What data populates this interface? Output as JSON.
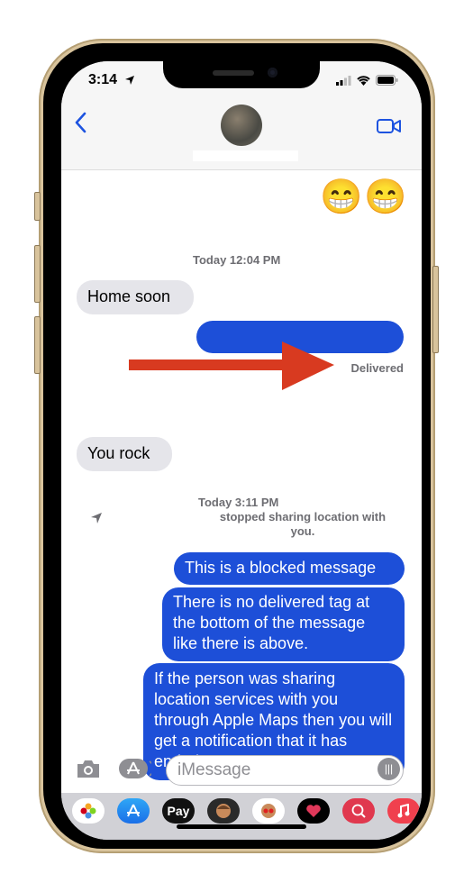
{
  "status_bar": {
    "time": "3:14"
  },
  "header": {
    "back_label": "‹"
  },
  "emojis": [
    "😁",
    "😁"
  ],
  "messages": {
    "timestamp_1": "Today 12:04 PM",
    "home_soon": "Home soon",
    "delivered": "Delivered",
    "you_rock": "You rock",
    "timestamp_2": "Today 3:11 PM",
    "location_notice": "stopped sharing location with you.",
    "blocked": "This is a blocked message",
    "no_tag": "There is no delivered tag at the bottom of the message like there is above.",
    "location_info": "If the person was sharing location services with you through Apple Maps then you will get a notification that it has ended."
  },
  "input": {
    "placeholder": "iMessage"
  },
  "tray": {
    "apple_pay_label": "Pay"
  },
  "colors": {
    "outgoing": "#1d4fd8",
    "incoming": "#e5e5ea",
    "accent": "#1d53e0",
    "annotation_arrow": "#d83a20"
  }
}
